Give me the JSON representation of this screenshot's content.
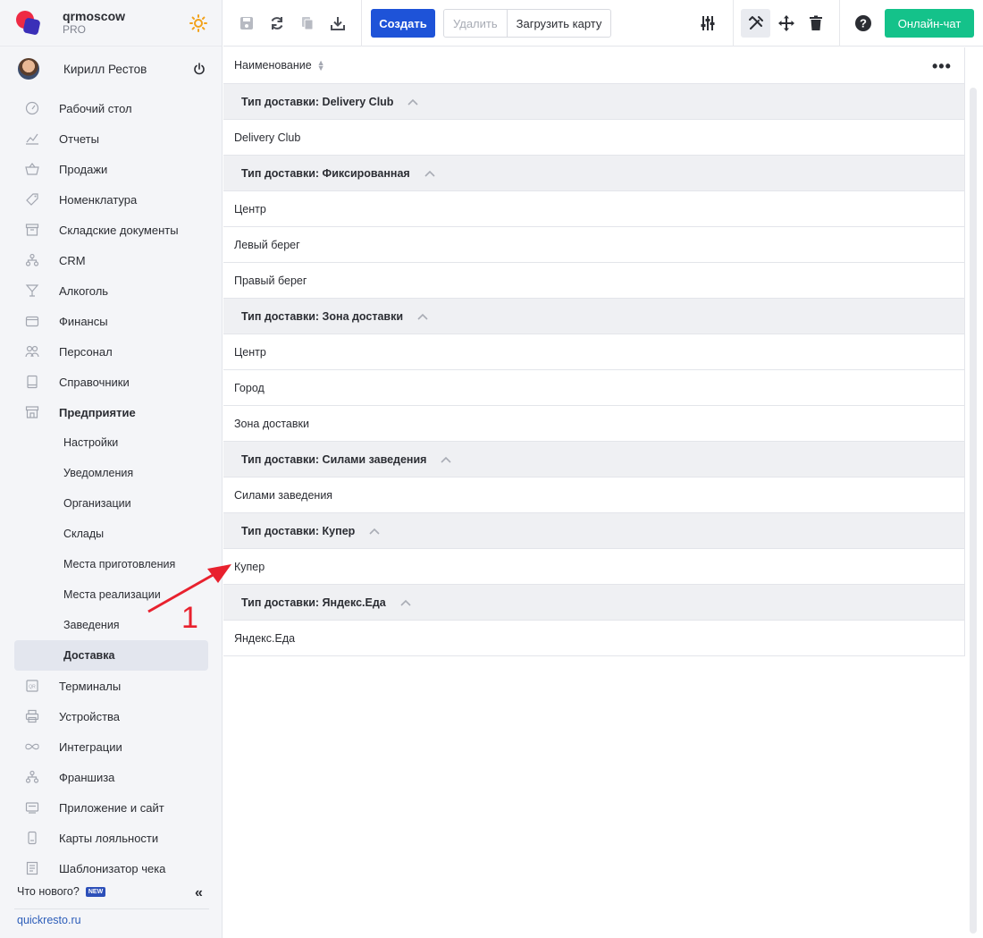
{
  "brand": {
    "name": "qrmoscow",
    "plan": "PRO"
  },
  "user": {
    "name": "Кирилл Рестов"
  },
  "menu": [
    {
      "label": "Рабочий стол",
      "icon": "dashboard-icon"
    },
    {
      "label": "Отчеты",
      "icon": "chart-icon"
    },
    {
      "label": "Продажи",
      "icon": "basket-icon"
    },
    {
      "label": "Номенклатура",
      "icon": "tag-icon"
    },
    {
      "label": "Складские документы",
      "icon": "archive-icon"
    },
    {
      "label": "CRM",
      "icon": "crm-icon"
    },
    {
      "label": "Алкоголь",
      "icon": "glass-icon"
    },
    {
      "label": "Финансы",
      "icon": "wallet-icon"
    },
    {
      "label": "Персонал",
      "icon": "people-icon"
    },
    {
      "label": "Справочники",
      "icon": "book-icon"
    },
    {
      "label": "Предприятие",
      "icon": "store-icon"
    }
  ],
  "submenu": [
    "Настройки",
    "Уведомления",
    "Организации",
    "Склады",
    "Места приготовления",
    "Места реализации",
    "Заведения",
    "Доставка"
  ],
  "menu2": [
    {
      "label": "Терминалы",
      "icon": "terminal-icon"
    },
    {
      "label": "Устройства",
      "icon": "printer-icon"
    },
    {
      "label": "Интеграции",
      "icon": "infinity-icon"
    },
    {
      "label": "Франшиза",
      "icon": "franchise-icon"
    },
    {
      "label": "Приложение и сайт",
      "icon": "app-icon"
    },
    {
      "label": "Карты лояльности",
      "icon": "card-icon"
    },
    {
      "label": "Шаблонизатор чека",
      "icon": "receipt-icon"
    }
  ],
  "footer": {
    "whats_new": "Что нового?",
    "badge": "NEW",
    "site": "quickresto.ru"
  },
  "toolbar": {
    "create": "Создать",
    "delete": "Удалить",
    "load_card": "Загрузить карту",
    "chat": "Онлайн-чат"
  },
  "table": {
    "column": "Наименование",
    "groups": [
      {
        "title": "Тип доставки: Delivery Club",
        "rows": [
          "Delivery Club"
        ]
      },
      {
        "title": "Тип доставки: Фиксированная",
        "rows": [
          "Центр",
          "Левый берег",
          "Правый берег"
        ]
      },
      {
        "title": "Тип доставки: Зона доставки",
        "rows": [
          "Центр",
          "Город",
          "Зона доставки"
        ]
      },
      {
        "title": "Тип доставки: Силами заведения",
        "rows": [
          "Силами заведения"
        ]
      },
      {
        "title": "Тип доставки: Купер",
        "rows": [
          "Купер"
        ]
      },
      {
        "title": "Тип доставки: Яндекс.Еда",
        "rows": [
          "Яндекс.Еда"
        ]
      }
    ]
  },
  "annotation": {
    "number": "1",
    "color": "#e8212e"
  },
  "colors": {
    "accent": "#1e53d8",
    "chat": "#14c28a",
    "brand_red": "#ee2a44",
    "brand_blue": "#3a2fb8"
  }
}
